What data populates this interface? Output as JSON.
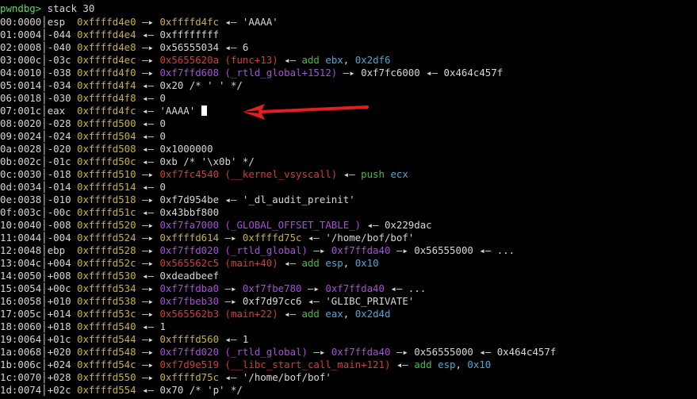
{
  "prompt": {
    "text": "pwndbg>",
    "command": " stack 30"
  },
  "colors": {
    "stack": "#c8b42a",
    "heap": "#5b6ee0",
    "code": "#d23c3c",
    "data": "#a64ed8",
    "mnemonic": "#3fbf3f",
    "register": "#4aa8d8",
    "annotation_arrow": "#e02020"
  },
  "lines": [
    {
      "idx": "00:0000",
      "off": "esp ",
      "segs": [
        {
          "t": "0xffffd4e0",
          "c": "stack"
        },
        {
          "t": " —▸ "
        },
        {
          "t": "0xffffd4fc",
          "c": "stack"
        },
        {
          "t": " ◂— 'AAAA'"
        }
      ]
    },
    {
      "idx": "01:0004",
      "off": "-044",
      "segs": [
        {
          "t": "0xffffd4e4",
          "c": "stack"
        },
        {
          "t": " ◂— 0xffffffff"
        }
      ]
    },
    {
      "idx": "02:0008",
      "off": "-040",
      "segs": [
        {
          "t": "0xffffd4e8",
          "c": "stack"
        },
        {
          "t": " —▸ 0x56555034 ◂— 6"
        }
      ]
    },
    {
      "idx": "03:000c",
      "off": "-03c",
      "segs": [
        {
          "t": "0xffffd4ec",
          "c": "stack"
        },
        {
          "t": " —▸ "
        },
        {
          "t": "0x5655620a",
          "c": "code"
        },
        {
          "t": " "
        },
        {
          "t": "(func+13)",
          "c": "code"
        },
        {
          "t": " ◂— "
        },
        {
          "t": "add",
          "c": "mnemonic"
        },
        {
          "t": " "
        },
        {
          "t": "ebx",
          "c": "register"
        },
        {
          "t": ", "
        },
        {
          "t": "0x2df6",
          "c": "register"
        }
      ]
    },
    {
      "idx": "04:0010",
      "off": "-038",
      "segs": [
        {
          "t": "0xffffd4f0",
          "c": "stack"
        },
        {
          "t": " —▸ "
        },
        {
          "t": "0xf7ffd608",
          "c": "data"
        },
        {
          "t": " "
        },
        {
          "t": "(_rtld_global+1512)",
          "c": "data"
        },
        {
          "t": " —▸ 0xf7fc6000 ◂— 0x464c457f"
        }
      ]
    },
    {
      "idx": "05:0014",
      "off": "-034",
      "segs": [
        {
          "t": "0xffffd4f4",
          "c": "stack"
        },
        {
          "t": " ◂— 0x20 /* ' ' */"
        }
      ]
    },
    {
      "idx": "06:0018",
      "off": "-030",
      "segs": [
        {
          "t": "0xffffd4f8",
          "c": "stack"
        },
        {
          "t": " ◂— 0"
        }
      ]
    },
    {
      "idx": "07:001c",
      "off": "eax ",
      "segs": [
        {
          "t": "0xffffd4fc",
          "c": "stack"
        },
        {
          "t": " ◂— 'AAAA' "
        }
      ],
      "cursor": true
    },
    {
      "idx": "08:0020",
      "off": "-028",
      "segs": [
        {
          "t": "0xffffd500",
          "c": "stack"
        },
        {
          "t": " ◂— 0"
        }
      ]
    },
    {
      "idx": "09:0024",
      "off": "-024",
      "segs": [
        {
          "t": "0xffffd504",
          "c": "stack"
        },
        {
          "t": " ◂— 0"
        }
      ]
    },
    {
      "idx": "0a:0028",
      "off": "-020",
      "segs": [
        {
          "t": "0xffffd508",
          "c": "stack"
        },
        {
          "t": " ◂— 0x1000000"
        }
      ]
    },
    {
      "idx": "0b:002c",
      "off": "-01c",
      "segs": [
        {
          "t": "0xffffd50c",
          "c": "stack"
        },
        {
          "t": " ◂— 0xb /* '\\x0b' */"
        }
      ]
    },
    {
      "idx": "0c:0030",
      "off": "-018",
      "segs": [
        {
          "t": "0xffffd510",
          "c": "stack"
        },
        {
          "t": " —▸ "
        },
        {
          "t": "0xf7fc4540",
          "c": "code"
        },
        {
          "t": " "
        },
        {
          "t": "(__kernel_vsyscall)",
          "c": "code"
        },
        {
          "t": " ◂— "
        },
        {
          "t": "push",
          "c": "mnemonic"
        },
        {
          "t": " "
        },
        {
          "t": "ecx",
          "c": "register"
        }
      ]
    },
    {
      "idx": "0d:0034",
      "off": "-014",
      "segs": [
        {
          "t": "0xffffd514",
          "c": "stack"
        },
        {
          "t": " ◂— 0"
        }
      ]
    },
    {
      "idx": "0e:0038",
      "off": "-010",
      "segs": [
        {
          "t": "0xffffd518",
          "c": "stack"
        },
        {
          "t": " —▸ 0xf7d954be ◂— '_dl_audit_preinit'"
        }
      ]
    },
    {
      "idx": "0f:003c",
      "off": "-00c",
      "segs": [
        {
          "t": "0xffffd51c",
          "c": "stack"
        },
        {
          "t": " ◂— 0x43bbf800"
        }
      ]
    },
    {
      "idx": "10:0040",
      "off": "-008",
      "segs": [
        {
          "t": "0xffffd520",
          "c": "stack"
        },
        {
          "t": " —▸ "
        },
        {
          "t": "0xf7fa7000",
          "c": "data"
        },
        {
          "t": " "
        },
        {
          "t": "(_GLOBAL_OFFSET_TABLE_)",
          "c": "data"
        },
        {
          "t": " ◂— 0x229dac"
        }
      ]
    },
    {
      "idx": "11:0044",
      "off": "-004",
      "segs": [
        {
          "t": "0xffffd524",
          "c": "stack"
        },
        {
          "t": " —▸ "
        },
        {
          "t": "0xffffd614",
          "c": "stack"
        },
        {
          "t": " —▸ "
        },
        {
          "t": "0xffffd75c",
          "c": "stack"
        },
        {
          "t": " ◂— '/home/bof/bof'"
        }
      ]
    },
    {
      "idx": "12:0048",
      "off": "ebp ",
      "segs": [
        {
          "t": "0xffffd528",
          "c": "stack"
        },
        {
          "t": " —▸ "
        },
        {
          "t": "0xf7ffd020",
          "c": "data"
        },
        {
          "t": " "
        },
        {
          "t": "(_rtld_global)",
          "c": "data"
        },
        {
          "t": " —▸ "
        },
        {
          "t": "0xf7ffda40",
          "c": "data"
        },
        {
          "t": " —▸ 0x56555000 ◂— ..."
        }
      ]
    },
    {
      "idx": "13:004c",
      "off": "+004",
      "segs": [
        {
          "t": "0xffffd52c",
          "c": "stack"
        },
        {
          "t": " —▸ "
        },
        {
          "t": "0x565562c5",
          "c": "code"
        },
        {
          "t": " "
        },
        {
          "t": "(main+40)",
          "c": "code"
        },
        {
          "t": " ◂— "
        },
        {
          "t": "add",
          "c": "mnemonic"
        },
        {
          "t": " "
        },
        {
          "t": "esp",
          "c": "register"
        },
        {
          "t": ", "
        },
        {
          "t": "0x10",
          "c": "register"
        }
      ]
    },
    {
      "idx": "14:0050",
      "off": "+008",
      "segs": [
        {
          "t": "0xffffd530",
          "c": "stack"
        },
        {
          "t": " ◂— 0xdeadbeef"
        }
      ]
    },
    {
      "idx": "15:0054",
      "off": "+00c",
      "segs": [
        {
          "t": "0xffffd534",
          "c": "stack"
        },
        {
          "t": " —▸ "
        },
        {
          "t": "0xf7ffdba0",
          "c": "data"
        },
        {
          "t": " —▸ "
        },
        {
          "t": "0xf7fbe780",
          "c": "data"
        },
        {
          "t": " —▸ "
        },
        {
          "t": "0xf7ffda40",
          "c": "data"
        },
        {
          "t": " ◂— ..."
        }
      ]
    },
    {
      "idx": "16:0058",
      "off": "+010",
      "segs": [
        {
          "t": "0xffffd538",
          "c": "stack"
        },
        {
          "t": " —▸ "
        },
        {
          "t": "0xf7fbeb30",
          "c": "data"
        },
        {
          "t": " —▸ 0xf7d97cc6 ◂— 'GLIBC_PRIVATE'"
        }
      ]
    },
    {
      "idx": "17:005c",
      "off": "+014",
      "segs": [
        {
          "t": "0xffffd53c",
          "c": "stack"
        },
        {
          "t": " —▸ "
        },
        {
          "t": "0x565562b3",
          "c": "code"
        },
        {
          "t": " "
        },
        {
          "t": "(main+22)",
          "c": "code"
        },
        {
          "t": " ◂— "
        },
        {
          "t": "add",
          "c": "mnemonic"
        },
        {
          "t": " "
        },
        {
          "t": "eax",
          "c": "register"
        },
        {
          "t": ", "
        },
        {
          "t": "0x2d4d",
          "c": "register"
        }
      ]
    },
    {
      "idx": "18:0060",
      "off": "+018",
      "segs": [
        {
          "t": "0xffffd540",
          "c": "stack"
        },
        {
          "t": " ◂— 1"
        }
      ]
    },
    {
      "idx": "19:0064",
      "off": "+01c",
      "segs": [
        {
          "t": "0xffffd544",
          "c": "stack"
        },
        {
          "t": " —▸ "
        },
        {
          "t": "0xffffd560",
          "c": "stack"
        },
        {
          "t": " ◂— 1"
        }
      ]
    },
    {
      "idx": "1a:0068",
      "off": "+020",
      "segs": [
        {
          "t": "0xffffd548",
          "c": "stack"
        },
        {
          "t": " —▸ "
        },
        {
          "t": "0xf7ffd020",
          "c": "data"
        },
        {
          "t": " "
        },
        {
          "t": "(_rtld_global)",
          "c": "data"
        },
        {
          "t": " —▸ "
        },
        {
          "t": "0xf7ffda40",
          "c": "data"
        },
        {
          "t": " —▸ 0x56555000 ◂— 0x464c457f"
        }
      ]
    },
    {
      "idx": "1b:006c",
      "off": "+024",
      "segs": [
        {
          "t": "0xffffd54c",
          "c": "stack"
        },
        {
          "t": " —▸ "
        },
        {
          "t": "0xf7d9e519",
          "c": "code"
        },
        {
          "t": " "
        },
        {
          "t": "(__libc_start_call_main+121)",
          "c": "code"
        },
        {
          "t": " ◂— "
        },
        {
          "t": "add",
          "c": "mnemonic"
        },
        {
          "t": " "
        },
        {
          "t": "esp",
          "c": "register"
        },
        {
          "t": ", "
        },
        {
          "t": "0x10",
          "c": "register"
        }
      ]
    },
    {
      "idx": "1c:0070",
      "off": "+028",
      "segs": [
        {
          "t": "0xffffd550",
          "c": "stack"
        },
        {
          "t": " —▸ "
        },
        {
          "t": "0xffffd75c",
          "c": "stack"
        },
        {
          "t": " ◂— '/home/bof/bof'"
        }
      ]
    },
    {
      "idx": "1d:0074",
      "off": "+02c",
      "segs": [
        {
          "t": "0xffffd554",
          "c": "stack"
        },
        {
          "t": " ◂— 0x70 /* 'p' */"
        }
      ]
    }
  ]
}
